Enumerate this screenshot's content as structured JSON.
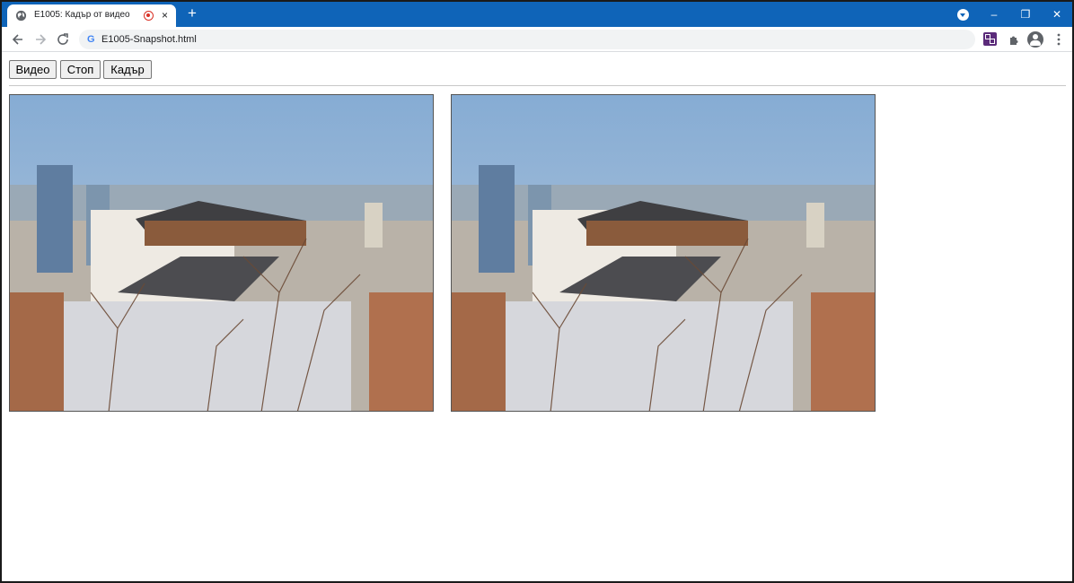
{
  "browser": {
    "tab_title": "E1005: Кадър от видео",
    "tab_close": "×",
    "new_tab": "+",
    "url": "E1005-Snapshot.html",
    "google_glyph": "G",
    "icons": {
      "favicon": "globe-icon",
      "recording": "recording-icon",
      "back": "back-arrow-icon",
      "forward": "forward-arrow-icon",
      "reload": "reload-icon",
      "extension_qr": "qr-code-icon",
      "extensions": "puzzle-icon",
      "account": "account-icon",
      "menu": "kebab-menu-icon"
    },
    "window_controls": {
      "minimize": "–",
      "restore": "❐",
      "close": "✕"
    },
    "accent_color": "#0f64b8"
  },
  "page": {
    "buttons": {
      "video": "Видео",
      "stop": "Стоп",
      "frame": "Кадър"
    }
  }
}
